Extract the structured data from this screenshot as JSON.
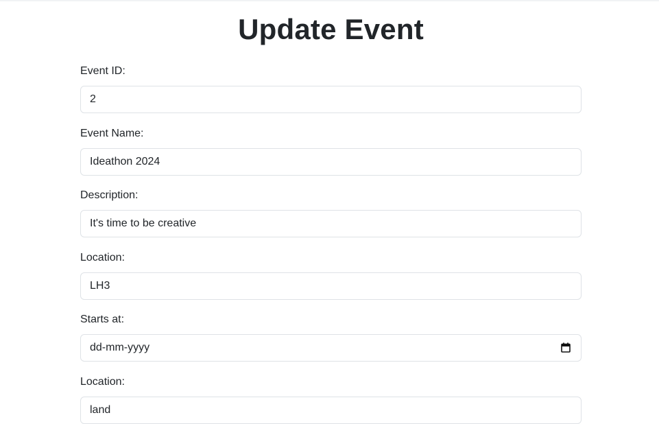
{
  "page": {
    "title": "Update Event"
  },
  "form": {
    "fields": [
      {
        "label": "Event ID:",
        "value": "2"
      },
      {
        "label": "Event Name:",
        "value": "Ideathon 2024"
      },
      {
        "label": "Description:",
        "value": "It's time to be creative"
      },
      {
        "label": "Location:",
        "value": "LH3"
      },
      {
        "label": "Starts at:",
        "value": "",
        "placeholder": "dd-mm-yyyy",
        "icon": "calendar-icon"
      },
      {
        "label": "Location:",
        "value": "land"
      }
    ]
  }
}
